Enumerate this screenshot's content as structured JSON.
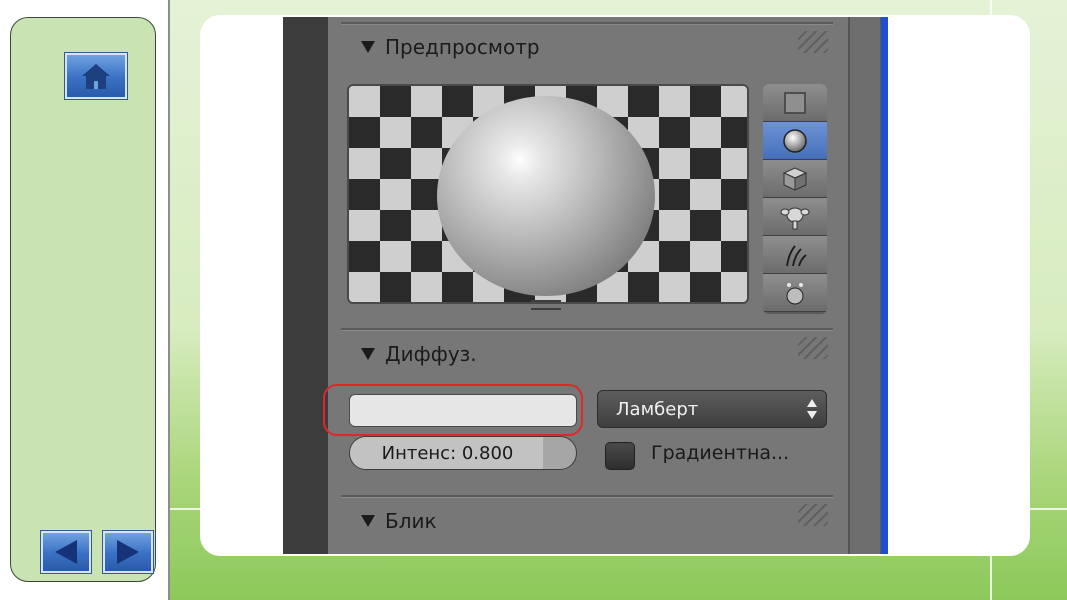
{
  "slide": {
    "nav": {
      "home_icon": "home-icon",
      "prev_icon": "arrow-left-icon",
      "next_icon": "arrow-right-icon"
    }
  },
  "blender": {
    "preview_section": {
      "title": "Предпросмотр"
    },
    "preview_shapes": [
      {
        "icon": "flat-square-icon",
        "active": false
      },
      {
        "icon": "sphere-icon",
        "active": true
      },
      {
        "icon": "cube-icon",
        "active": false
      },
      {
        "icon": "monkey-icon",
        "active": false
      },
      {
        "icon": "hair-strands-icon",
        "active": false
      },
      {
        "icon": "sky-sphere-icon",
        "active": false
      }
    ],
    "diffuse_section": {
      "title": "Диффуз.",
      "color": "#e6e6e6",
      "shader": "Ламберт",
      "intensity_label": "Интенс: 0.800",
      "intensity_value": 0.8,
      "ramp_label": "Градиентна...",
      "ramp_checked": false
    },
    "specular_section": {
      "title": "Блик"
    },
    "highlight_color": "#e02828"
  }
}
